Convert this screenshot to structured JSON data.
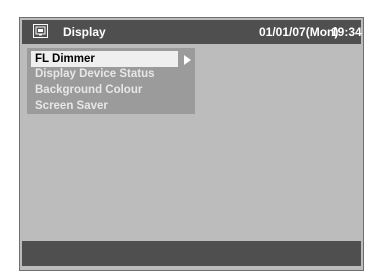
{
  "header": {
    "icon": "display-settings-icon",
    "title": "Display",
    "date": "01/01/07(Mon)",
    "time": "19:34"
  },
  "menu": {
    "items": [
      {
        "label": "FL Dimmer",
        "selected": true
      },
      {
        "label": "Display Device Status",
        "selected": false
      },
      {
        "label": "Background Colour",
        "selected": false
      },
      {
        "label": "Screen Saver",
        "selected": false
      }
    ],
    "submenu_indicator": "right-arrow-icon"
  },
  "colors": {
    "panel_background": "#bcbcbc",
    "header_background": "#4f4f4f",
    "menu_background": "#9b9b9b",
    "selected_background": "#efefef",
    "menu_text": "#e7e7e7",
    "header_text": "#ffffff"
  }
}
